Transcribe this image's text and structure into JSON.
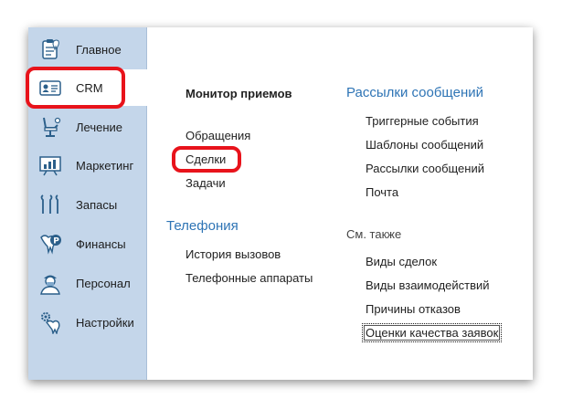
{
  "sidebar": {
    "items": [
      {
        "label": "Главное",
        "icon": "clipboard-tooth-icon"
      },
      {
        "label": "CRM",
        "icon": "id-card-icon"
      },
      {
        "label": "Лечение",
        "icon": "dental-chair-icon"
      },
      {
        "label": "Маркетинг",
        "icon": "chart-board-icon"
      },
      {
        "label": "Запасы",
        "icon": "dental-tools-icon"
      },
      {
        "label": "Финансы",
        "icon": "tooth-coin-icon"
      },
      {
        "label": "Персонал",
        "icon": "doctor-icon"
      },
      {
        "label": "Настройки",
        "icon": "tooth-gear-icon"
      }
    ],
    "active": "CRM"
  },
  "main": {
    "col1": {
      "header": "Монитор приемов",
      "links": [
        "Обращения",
        "Сделки",
        "Задачи"
      ]
    },
    "telephony": {
      "header": "Телефония",
      "links": [
        "История вызовов",
        "Телефонные аппараты"
      ]
    },
    "col2": {
      "header": "Рассылки сообщений",
      "links": [
        "Триггерные события",
        "Шаблоны сообщений",
        "Рассылки сообщений",
        "Почта"
      ]
    },
    "see_also": {
      "header": "См. также",
      "links": [
        "Виды сделок",
        "Виды взаимодействий",
        "Причины отказов",
        "Оценки качества заявок"
      ]
    }
  },
  "colors": {
    "sidebar_bg": "#c4d6ea",
    "accent_blue": "#2e74b5",
    "highlight_red": "#e8131b"
  }
}
